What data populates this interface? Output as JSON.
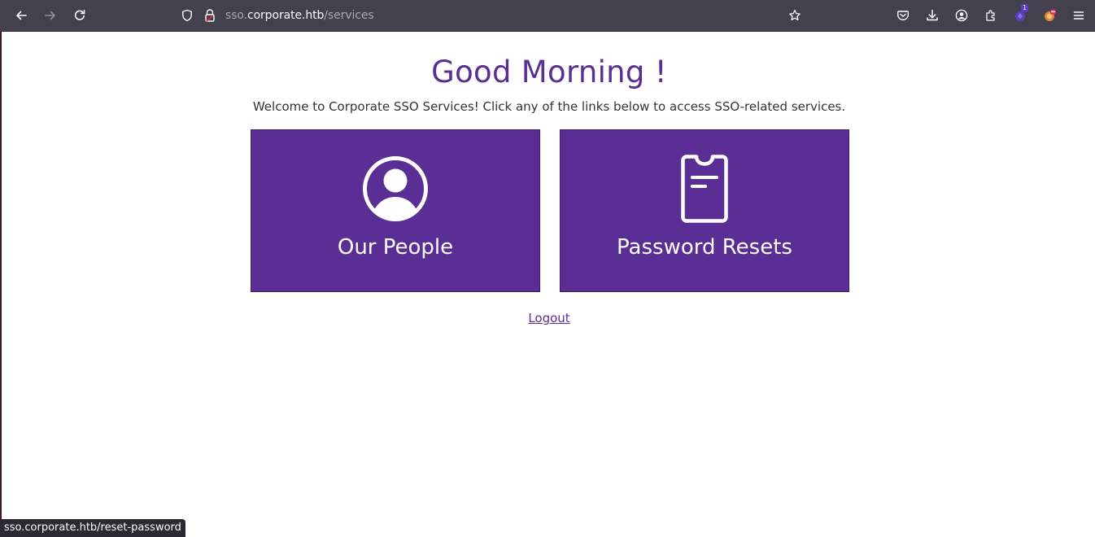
{
  "browser": {
    "url": {
      "subdomain": "sso.",
      "domain": "corporate.htb",
      "path": "/services"
    },
    "extension_badge": "1",
    "icons": [
      "back-arrow-icon",
      "forward-arrow-icon",
      "reload-icon",
      "shield-icon",
      "lock-icon",
      "bookmark-star-icon",
      "pocket-icon",
      "download-icon",
      "account-icon",
      "extensions-icon",
      "extension-purple-icon",
      "extension-orange-icon",
      "menu-icon"
    ]
  },
  "page": {
    "heading": "Good Morning !",
    "subtitle": "Welcome to Corporate SSO Services! Click any of the links below to access SSO-related services.",
    "cards": [
      {
        "label": "Our People",
        "icon": "person-circle-icon"
      },
      {
        "label": "Password Resets",
        "icon": "clipboard-device-icon"
      }
    ],
    "logout_label": "Logout"
  },
  "status_bar": {
    "text": "sso.corporate.htb/reset-password"
  },
  "colors": {
    "brand_purple": "#5a2e95",
    "toolbar_bg": "#42414d"
  }
}
